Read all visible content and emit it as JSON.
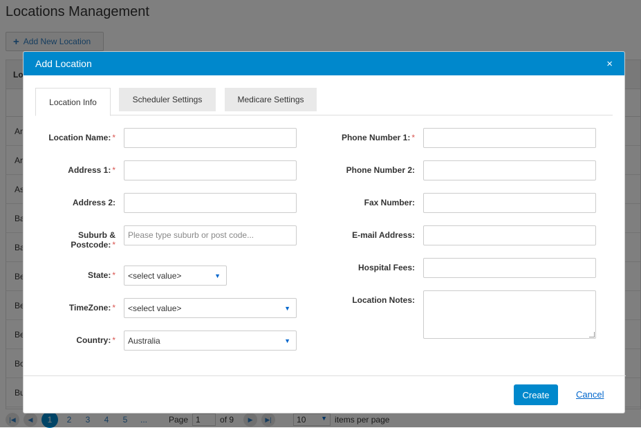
{
  "page": {
    "title": "Locations Management",
    "add_button": "Add New Location",
    "table_header": "Lo",
    "rows": [
      "An",
      "Ar",
      "As",
      "Ba",
      "Ba",
      "Be",
      "Be",
      "Be",
      "Bo",
      "Bu"
    ]
  },
  "pager": {
    "pages": [
      "1",
      "2",
      "3",
      "4",
      "5",
      "..."
    ],
    "page_label": "Page",
    "page_value": "1",
    "of_label": "of 9",
    "page_size": "10",
    "items_label": "items per page"
  },
  "modal": {
    "title": "Add Location",
    "close": "×",
    "tabs": [
      "Location Info",
      "Scheduler Settings",
      "Medicare Settings"
    ],
    "left_fields": {
      "location_name": "Location Name:",
      "address1": "Address 1:",
      "address2": "Address 2:",
      "suburb": "Suburb & Postcode:",
      "suburb_placeholder": "Please type suburb or post code...",
      "state": "State:",
      "state_value": "<select value>",
      "timezone": "TimeZone:",
      "timezone_value": "<select value>",
      "country": "Country:",
      "country_value": "Australia"
    },
    "right_fields": {
      "phone1": "Phone Number 1:",
      "phone2": "Phone Number 2:",
      "fax": "Fax Number:",
      "email": "E-mail Address:",
      "hospital_fees": "Hospital Fees:",
      "location_notes": "Location Notes:"
    },
    "required_mark": "*",
    "create": "Create",
    "cancel": "Cancel"
  }
}
